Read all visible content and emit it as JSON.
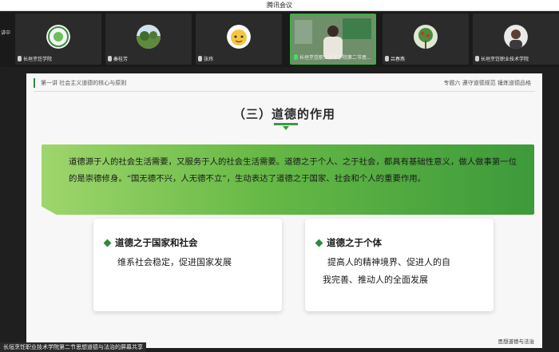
{
  "window": {
    "title": "腾讯会议"
  },
  "strip": {
    "left_label": "讲中",
    "tiles": [
      {
        "name": "长垣烹饪学院",
        "avatar": "school-logo"
      },
      {
        "name": "秦桂芳",
        "avatar": "landscape-photo"
      },
      {
        "name": "张炜",
        "avatar": "cartoon-avatar"
      },
      {
        "name": "长垣烹饪职业技术学院第二节思...",
        "avatar": "speaker-video",
        "active": true
      },
      {
        "name": "吕春燕",
        "avatar": "plant-photo"
      },
      {
        "name": "长垣烹饪职业技术学院",
        "avatar": "person-avatar"
      }
    ]
  },
  "slide": {
    "header_left": "第一讲 社会主义道德的核心与原则",
    "header_right": "专题六 遵守道德规范 锤炼道德品格",
    "heading": "（三）道德的作用",
    "banner_text": "道德源于人的社会生活需要，又服务于人的社会生活需要。道德之于个人、之于社会，都具有基础性意义，做人做事第一位的是崇德修身。“国无德不兴，人无德不立”，生动表达了道德之于国家、社会和个人的重要作用。",
    "card_left": {
      "title": "道德之于国家和社会",
      "body": "维系社会稳定，促进国家发展"
    },
    "card_right": {
      "title": "道德之于个体",
      "body_line1": "提高人的精神境界、促进人的自",
      "body_line2": "我完善、推动人的全面发展"
    },
    "footer_logo": "思想道德与法治"
  },
  "screen_share_label": "长垣烹饪职业技术学院第二节思想道德与法治的屏幕共享",
  "colors": {
    "accent": "#3a9a45",
    "banner_start": "#9fd66c",
    "banner_end": "#3d9a3a",
    "active_border": "#3fae49"
  }
}
